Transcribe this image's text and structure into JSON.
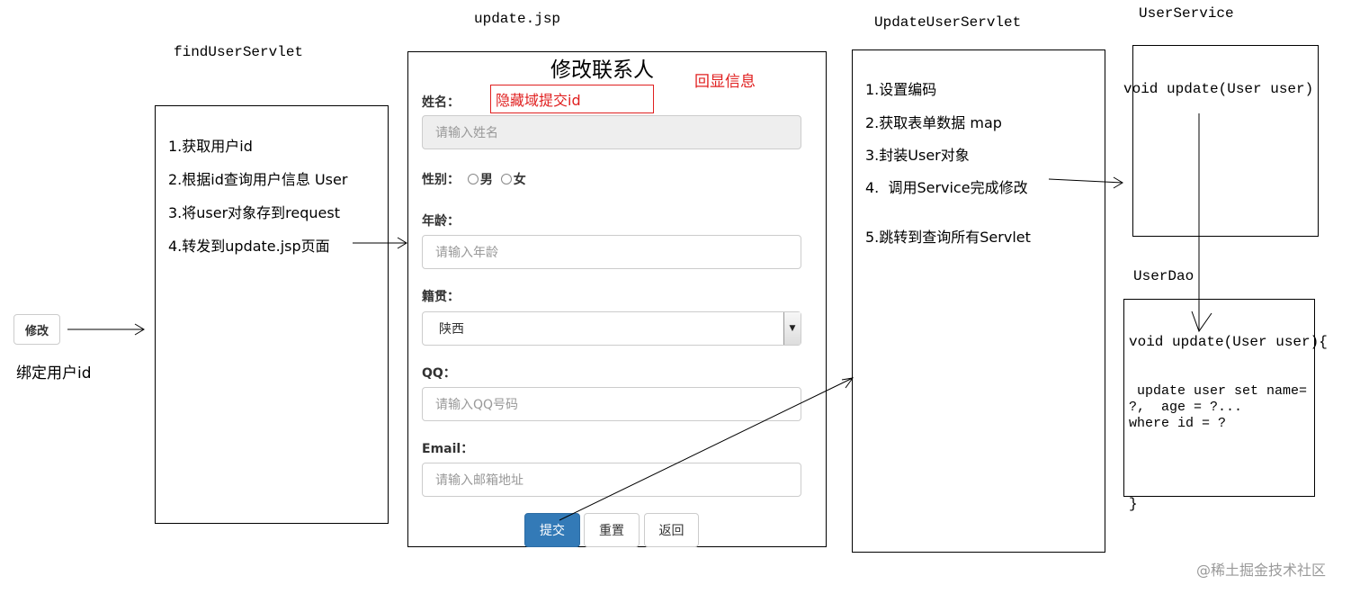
{
  "edit_button": {
    "label": "修改"
  },
  "bind_user_id": "绑定用户id",
  "find_servlet": {
    "title": "findUserServlet",
    "steps": [
      "1.获取用户id",
      "2.根据id查询用户信息 User",
      "3.将user对象存到request",
      "4.转发到update.jsp页面"
    ]
  },
  "update_jsp": {
    "title": "update.jsp",
    "heading": "修改联系人",
    "echo_note": "回显信息",
    "hidden_field_note": "隐藏域提交id",
    "fields": {
      "name": {
        "label": "姓名：",
        "placeholder": "请输入姓名"
      },
      "gender": {
        "label": "性别：",
        "options": [
          "男",
          "女"
        ]
      },
      "age": {
        "label": "年龄：",
        "placeholder": "请输入年龄"
      },
      "native_place": {
        "label": "籍贯：",
        "value": "陕西"
      },
      "qq": {
        "label": "QQ：",
        "placeholder": "请输入QQ号码"
      },
      "email": {
        "label": "Email：",
        "placeholder": "请输入邮箱地址"
      }
    },
    "buttons": {
      "submit": "提交",
      "reset": "重置",
      "back": "返回"
    }
  },
  "update_servlet": {
    "title": "UpdateUserServlet",
    "steps": [
      "1.设置编码",
      "2.获取表单数据 map",
      "3.封装User对象",
      "4.  调用Service完成修改",
      "5.跳转到查询所有Servlet"
    ]
  },
  "user_service": {
    "title": "UserService",
    "method": "void update(User user)"
  },
  "user_dao": {
    "title": "UserDao",
    "method": "void update(User user){",
    "sql_line1": "update user set name=",
    "sql_line2": "?,  age = ?...",
    "sql_line3": "where id = ?",
    "closing": "}"
  },
  "watermark": "@稀土掘金技术社区"
}
